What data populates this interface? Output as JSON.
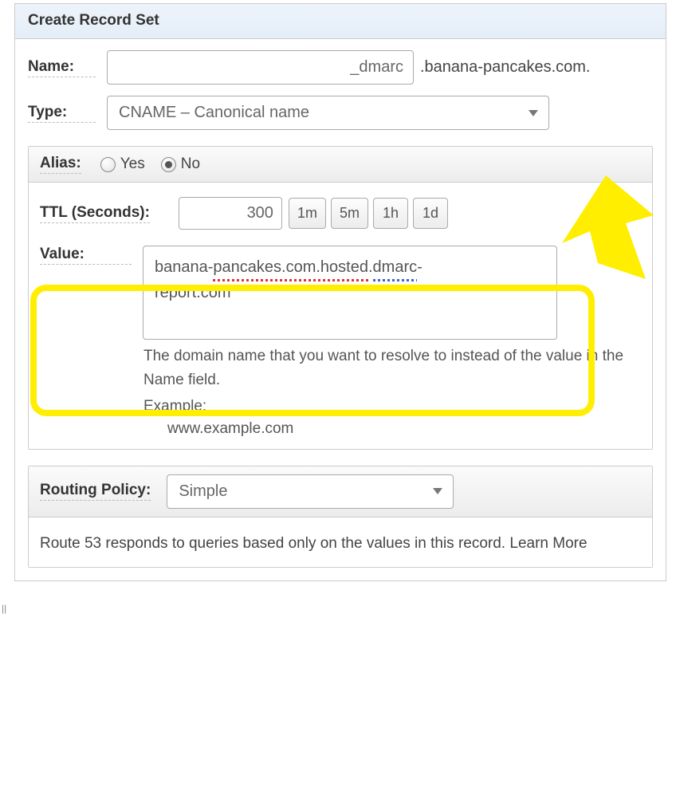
{
  "header": {
    "title": "Create Record Set"
  },
  "name": {
    "label": "Name:",
    "value": "_dmarc",
    "suffix": ".banana-pancakes.com."
  },
  "type": {
    "label": "Type:",
    "value": "CNAME – Canonical name"
  },
  "alias": {
    "label": "Alias:",
    "yes": "Yes",
    "no": "No",
    "selected": "no"
  },
  "ttl": {
    "label": "TTL (Seconds):",
    "value": "300",
    "presets": [
      "1m",
      "5m",
      "1h",
      "1d"
    ]
  },
  "value": {
    "label": "Value:",
    "text": "banana-pancakes.com.hosted.dmarc-report.com",
    "help": "The domain name that you want to resolve to instead of the value in the Name field.",
    "example_label": "Example:",
    "example_value": "www.example.com"
  },
  "routing": {
    "label": "Routing Policy:",
    "value": "Simple",
    "description": "Route 53 responds to queries based only on the values in this record.  ",
    "learn_more": "Learn More"
  },
  "colors": {
    "highlight": "#ffee00"
  }
}
